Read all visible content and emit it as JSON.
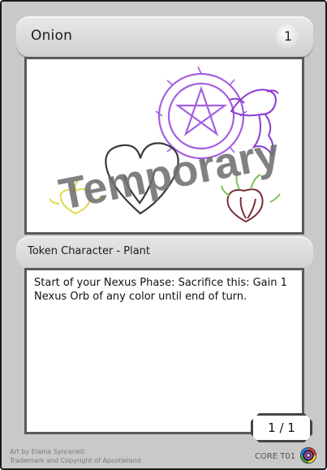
{
  "card": {
    "name": "Onion",
    "cost": "1",
    "watermark": "Temporary",
    "type_line": "Token Character - Plant",
    "rules_text": "Start of your Nexus Phase: Sacrifice this: Gain 1 Nexus Orb of any color until end of turn.",
    "count": "1 / 1",
    "credits": {
      "artist": "Art by Elaina Synraneit",
      "trademark": "Trademark and Copyright of Apostleland"
    },
    "set_code": "CORE T01",
    "set_symbol_icon": "rainbow-swirl-icon"
  },
  "colors": {
    "frame": "#c9c9c9",
    "watermark": "#6f6f6f",
    "art_purple": "#a45fe0",
    "art_yellow": "#e2d84a",
    "art_green": "#78c25a",
    "art_maroon": "#7a2f3a"
  }
}
